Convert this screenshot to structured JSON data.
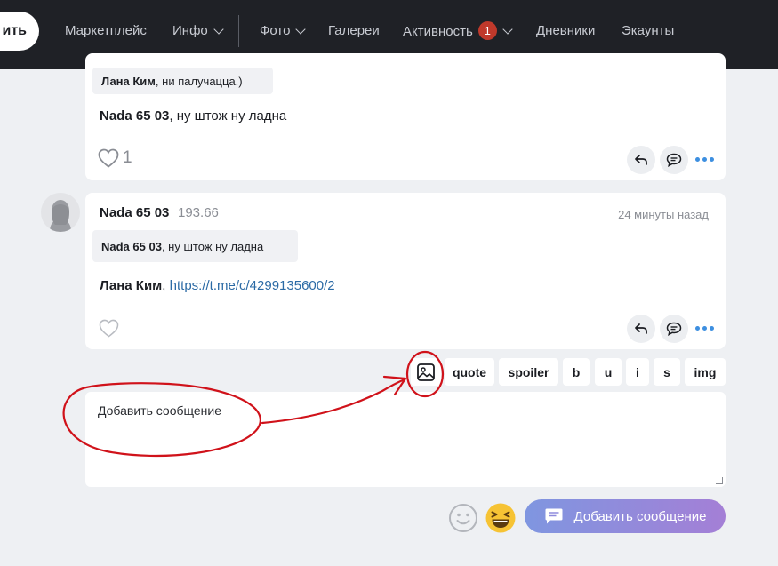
{
  "topbar": {
    "pill_label": "ить",
    "nav": [
      {
        "label": "Маркетплейс"
      },
      {
        "label": "Инфо"
      },
      {
        "label": "Фото"
      },
      {
        "label": "Галереи"
      },
      {
        "label": "Активность",
        "badge": "1"
      },
      {
        "label": "Дневники"
      },
      {
        "label": "Экаунты"
      }
    ]
  },
  "post1": {
    "quote_author": "Лана Ким",
    "quote_text": ", ни палучацца.)",
    "author": "Nada 65 03",
    "text": ", ну штож ну ладна",
    "likes": "1"
  },
  "post2": {
    "author": "Nada 65 03",
    "rating": "193.66",
    "time": "24 минуты назад",
    "quote_author": "Nada 65 03",
    "quote_text": ", ну штож ну ладна",
    "reply_to": "Лана Ким",
    "link": "https://t.me/c/4299135600/2"
  },
  "toolbar": {
    "buttons": [
      "quote",
      "spoiler",
      "b",
      "u",
      "i",
      "s",
      "img"
    ]
  },
  "editor": {
    "placeholder": "Добавить сообщение"
  },
  "submit_label": "Добавить сообщение",
  "colors": {
    "topbar_bg": "#1f2126",
    "badge": "#c0392b",
    "accent_dots": "#3d8fe0",
    "link": "#2b6aa5",
    "annotation": "#d0121a"
  }
}
